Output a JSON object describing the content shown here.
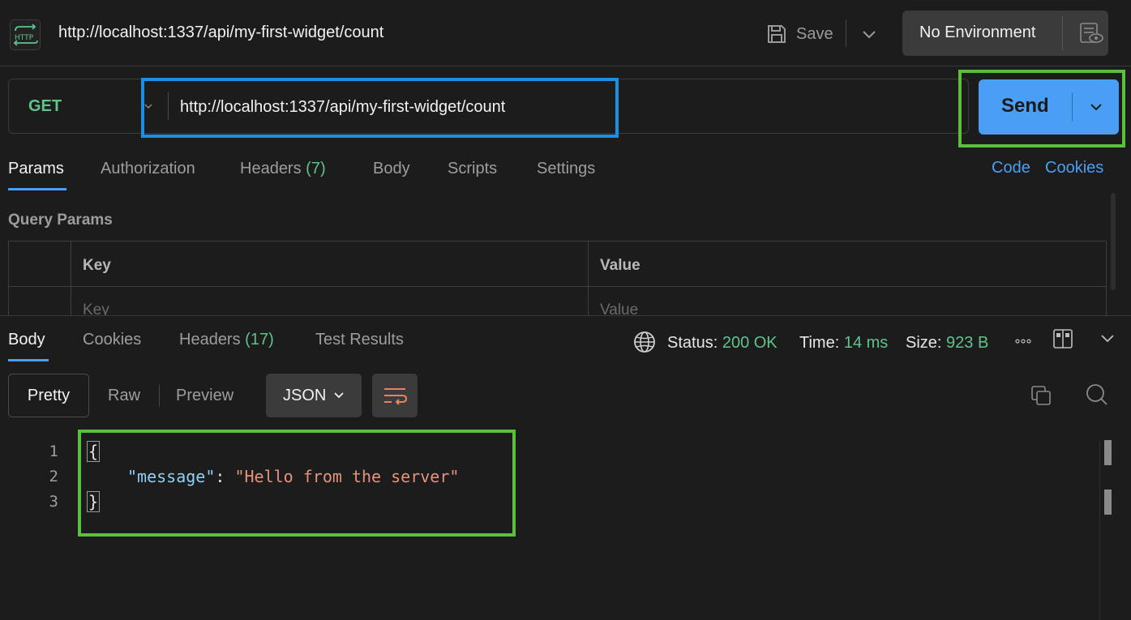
{
  "header": {
    "request_title": "http://localhost:1337/api/my-first-widget/count",
    "save_label": "Save",
    "environment_label": "No Environment"
  },
  "request": {
    "method": "GET",
    "url": "http://localhost:1337/api/my-first-widget/count",
    "send_label": "Send"
  },
  "request_tabs": {
    "params": "Params",
    "authorization": "Authorization",
    "headers": "Headers",
    "headers_count": "(7)",
    "body": "Body",
    "scripts": "Scripts",
    "settings": "Settings",
    "code_link": "Code",
    "cookies_link": "Cookies"
  },
  "query_params": {
    "title": "Query Params",
    "columns": [
      "Key",
      "Value"
    ],
    "placeholders": {
      "key": "Key",
      "value": "Value"
    }
  },
  "response_tabs": {
    "body": "Body",
    "cookies": "Cookies",
    "headers": "Headers",
    "headers_count": "(17)",
    "test_results": "Test Results"
  },
  "response_status": {
    "status_label": "Status:",
    "status_value": "200 OK",
    "time_label": "Time:",
    "time_value": "14 ms",
    "size_label": "Size:",
    "size_value": "923 B"
  },
  "view_modes": {
    "pretty": "Pretty",
    "raw": "Raw",
    "preview": "Preview",
    "format": "JSON"
  },
  "response_body": {
    "line_numbers": [
      "1",
      "2",
      "3"
    ],
    "open_brace": "{",
    "key": "\"message\"",
    "colon": ": ",
    "value": "\"Hello from the server\"",
    "close_brace": "}"
  },
  "colors": {
    "accent_blue": "#4a9ff5",
    "status_green": "#5ec48a",
    "highlight_blue": "#1a8fe3",
    "highlight_green": "#5bbe3c",
    "json_key": "#8fd0f5",
    "json_string": "#e6937a"
  },
  "icons": [
    "http-icon",
    "save-icon",
    "chevron-down-icon",
    "environment-eye-icon",
    "globe-icon",
    "more-icon",
    "layout-icon",
    "collapse-icon",
    "wrap-lines-icon",
    "copy-icon",
    "search-icon"
  ]
}
